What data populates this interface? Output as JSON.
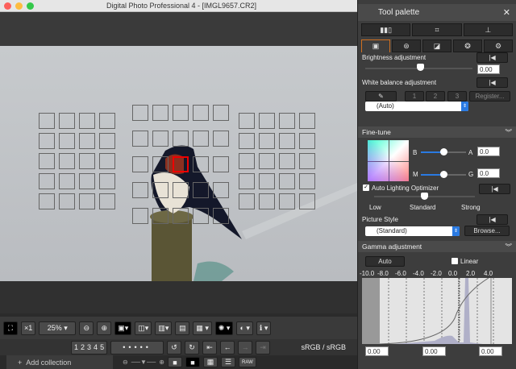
{
  "window": {
    "title": "Digital Photo Professional 4 - [IMGL9657.CR2]"
  },
  "toolbar": {
    "zoom_1x": "×1",
    "zoom_pct": "25%",
    "zoom_out_icon": "zoom-out-icon",
    "zoom_in_icon": "zoom-in-icon"
  },
  "ratings": [
    "1",
    "2",
    "3",
    "4",
    "5"
  ],
  "color_space": "sRGB / sRGB",
  "add_collection": "Add collection",
  "raw_label": "RAW",
  "palette": {
    "title": "Tool palette",
    "brightness": {
      "label": "Brightness adjustment",
      "value": "0.00",
      "slider_value": 0
    },
    "white_balance": {
      "label": "White balance adjustment",
      "presets": [
        "1",
        "2",
        "3"
      ],
      "register": "Register...",
      "mode": "(Auto)"
    },
    "fine_tune": {
      "label": "Fine-tune",
      "b": "B",
      "a": "A",
      "m": "M",
      "g": "G",
      "ba_value": "0.0",
      "mg_value": "0.0"
    },
    "alo": {
      "label": "Auto Lighting Optimizer",
      "checked": true,
      "levels": [
        "Low",
        "Standard",
        "Strong"
      ],
      "selected": "Standard"
    },
    "picture_style": {
      "label": "Picture Style",
      "value": "(Standard)",
      "browse": "Browse..."
    },
    "gamma": {
      "label": "Gamma adjustment",
      "auto": "Auto",
      "linear": "Linear",
      "linear_checked": false,
      "ticks": [
        "-10.0",
        "-8.0",
        "-6.0",
        "-4.0",
        "-2.0",
        "0.0",
        "2.0",
        "4.0"
      ],
      "values": [
        "0.00",
        "0.00",
        "0.00"
      ]
    }
  },
  "colors": {
    "accent": "#d07020",
    "selected_af": "#e00000",
    "select_blue": "#2a7ae2"
  }
}
